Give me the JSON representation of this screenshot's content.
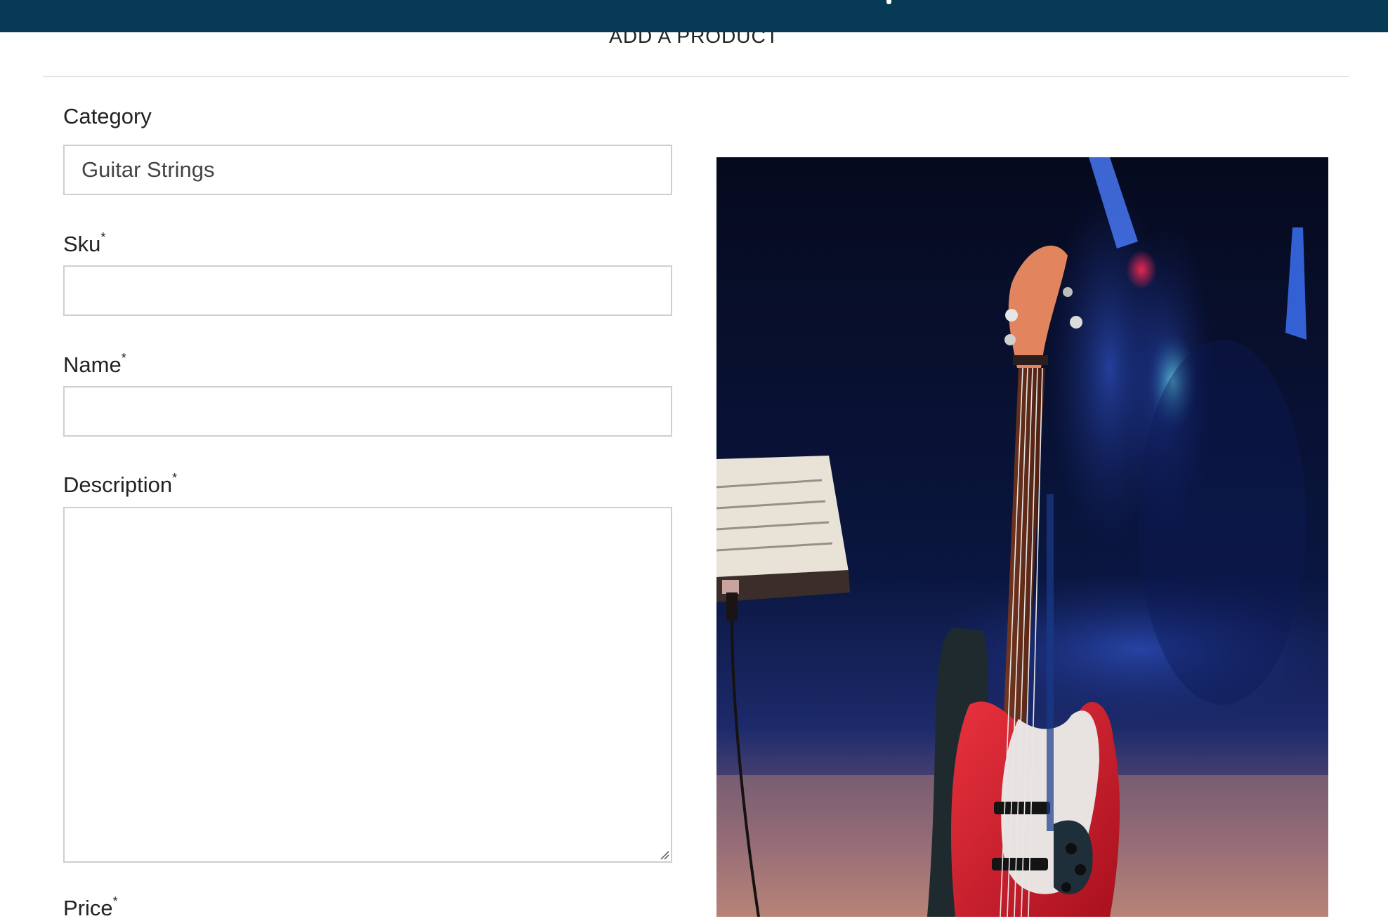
{
  "header": {
    "title": "ADD A PRODUCT"
  },
  "form": {
    "category": {
      "label": "Category",
      "value": "Guitar Strings"
    },
    "sku": {
      "label": "Sku",
      "required_mark": "*",
      "value": ""
    },
    "name": {
      "label": "Name",
      "required_mark": "*",
      "value": ""
    },
    "description": {
      "label": "Description",
      "required_mark": "*",
      "value": ""
    },
    "price": {
      "label": "Price",
      "required_mark": "*"
    }
  },
  "colors": {
    "topbar": "#073a55",
    "field_border": "#cfcfcf"
  }
}
